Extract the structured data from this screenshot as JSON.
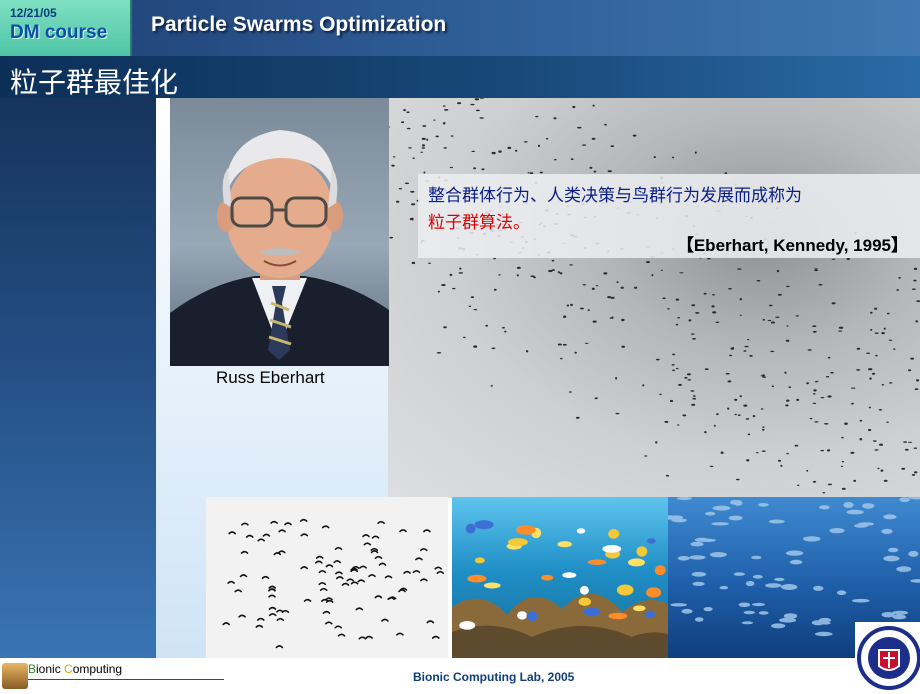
{
  "header": {
    "date": "12/21/05",
    "course": "DM course",
    "title": "Particle Swarms Optimization"
  },
  "subtitle": "粒子群最佳化",
  "portrait": {
    "caption": "Russ  Eberhart"
  },
  "quote": {
    "line1": "整合群体行为、人类决策与鸟群行为发展而成称为",
    "line2": "粒子群算法。",
    "citation": "【Eberhart,  Kennedy,  1995】"
  },
  "footer": {
    "lab": "Bionic Computing Lab, 2005",
    "brand": {
      "b": "B",
      "part1": "ionic ",
      "c": "C",
      "part2": "omputing"
    }
  },
  "colors": {
    "title_bar": "#2d5a92",
    "sub_bar": "#184878",
    "date_box": "#4fc4a6",
    "quote_text": "#0a1e86",
    "highlight": "#e10000",
    "brand_b": "#2e8b2e",
    "brand_c": "#d8a900"
  },
  "icons": [
    "bionic-logo-icon",
    "university-emblem-icon"
  ]
}
